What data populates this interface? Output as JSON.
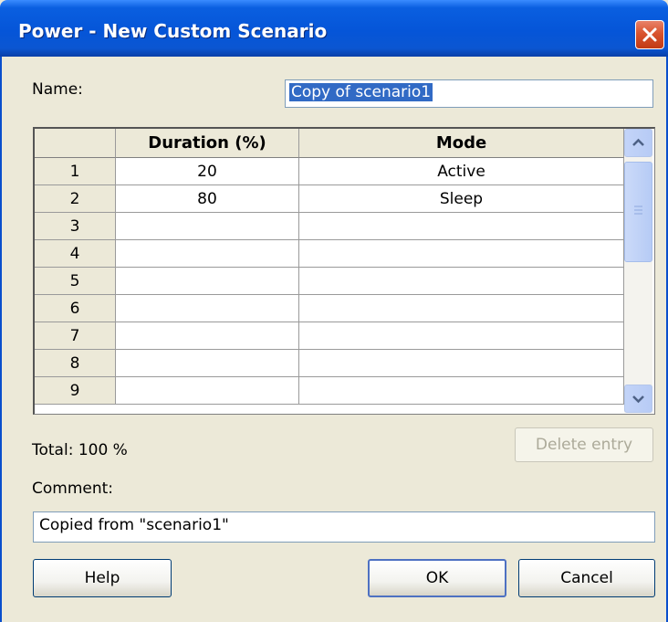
{
  "window": {
    "title": "Power - New Custom Scenario"
  },
  "name": {
    "label": "Name:",
    "value": "Copy of scenario1"
  },
  "table": {
    "headers": [
      "",
      "Duration (%)",
      "Mode"
    ],
    "rows": [
      {
        "num": "1",
        "duration": "20",
        "mode": "Active"
      },
      {
        "num": "2",
        "duration": "80",
        "mode": "Sleep"
      },
      {
        "num": "3",
        "duration": "",
        "mode": ""
      },
      {
        "num": "4",
        "duration": "",
        "mode": ""
      },
      {
        "num": "5",
        "duration": "",
        "mode": ""
      },
      {
        "num": "6",
        "duration": "",
        "mode": ""
      },
      {
        "num": "7",
        "duration": "",
        "mode": ""
      },
      {
        "num": "8",
        "duration": "",
        "mode": ""
      },
      {
        "num": "9",
        "duration": "",
        "mode": ""
      }
    ]
  },
  "total": {
    "label": "Total: 100 %"
  },
  "delete_button": {
    "label": "Delete entry",
    "enabled": false
  },
  "comment": {
    "label": "Comment:",
    "value": "Copied from \"scenario1\""
  },
  "buttons": {
    "help": "Help",
    "ok": "OK",
    "cancel": "Cancel"
  },
  "colors": {
    "titlebar": "#0555d8",
    "dialog_bg": "#ece9d8",
    "selection": "#316ac5"
  }
}
